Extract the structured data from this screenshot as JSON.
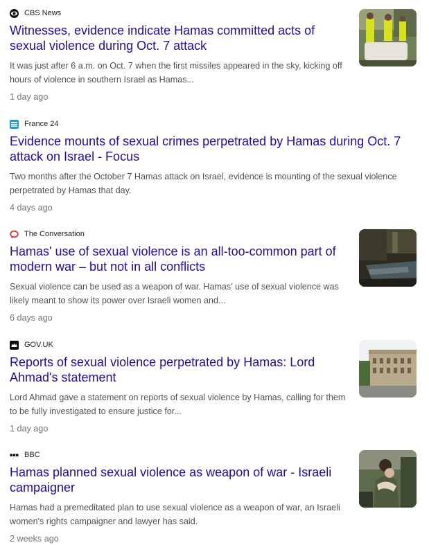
{
  "articles": [
    {
      "source": "CBS News",
      "source_icon": "cbs-eye-icon",
      "headline": "Witnesses, evidence indicate Hamas committed acts of sexual violence during Oct. 7 attack",
      "snippet": "It was just after 6 a.m. on Oct. 7 when the first missiles appeared in the sky, kicking off hours of violence in southern Israel as Hamas...",
      "age": "1 day ago",
      "has_thumbnail": true
    },
    {
      "source": "France 24",
      "source_icon": "france24-icon",
      "headline": "Evidence mounts of sexual crimes perpetrated by Hamas during Oct. 7 attack on Israel - Focus",
      "snippet": "Two months after the October 7 Hamas attack on Israel, evidence is mounting of the sexual violence perpetrated by Hamas that day.",
      "age": "4 days ago",
      "has_thumbnail": false
    },
    {
      "source": "The Conversation",
      "source_icon": "speech-bubble-icon",
      "headline": "Hamas' use of sexual violence is an all-too-common part of modern war – but not in all conflicts",
      "snippet": "Sexual violence can be used as a weapon of war. Hamas' use of sexual violence was likely meant to show its power over Israeli women and...",
      "age": "6 days ago",
      "has_thumbnail": true
    },
    {
      "source": "GOV.UK",
      "source_icon": "crown-icon",
      "headline": "Reports of sexual violence perpetrated by Hamas: Lord Ahmad's statement",
      "snippet": "Lord Ahmad gave a statement on reports of sexual violence by Hamas, calling for them to be fully investigated to ensure justice for...",
      "age": "1 day ago",
      "has_thumbnail": true
    },
    {
      "source": "BBC",
      "source_icon": "bbc-blocks-icon",
      "headline": "Hamas planned sexual violence as weapon of war - Israeli campaigner",
      "snippet": "Hamas had a premeditated plan to use sexual violence as a weapon of war, an Israeli women's rights campaigner and lawyer has said.",
      "age": "2 weeks ago",
      "has_thumbnail": true
    }
  ],
  "colors": {
    "headline": "#1a0dab",
    "snippet": "#4d5156",
    "age": "#70757a",
    "source": "#202124"
  }
}
